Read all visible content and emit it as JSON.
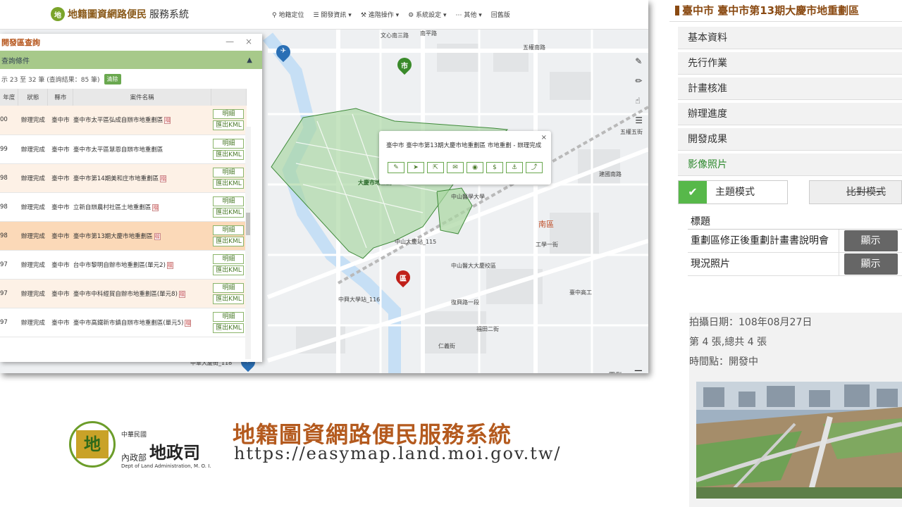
{
  "brand": {
    "logo": "地",
    "title_bold": "地籍圖資網路便民",
    "title_rest": "服務系統"
  },
  "menu": [
    {
      "icon": "pin-icon",
      "label": "地籍定位"
    },
    {
      "icon": "layers-icon",
      "label": "開發資訊"
    },
    {
      "icon": "tools-icon",
      "label": "進階操作"
    },
    {
      "icon": "gear-icon",
      "label": "系統設定"
    },
    {
      "icon": "more-icon",
      "label": "其他"
    },
    {
      "icon": "",
      "label": "回舊版"
    }
  ],
  "panel": {
    "title": "開發區查詢",
    "controls": "— ×",
    "condition_label": "查詢條件",
    "count_text": "示 23 至 32 筆 (查詢結果：85 筆)",
    "clear_label": "清除",
    "headers": [
      "年度",
      "狀態",
      "縣市",
      "案件名稱",
      ""
    ],
    "rows": [
      {
        "year": "00",
        "status": "辦理完成",
        "city": "臺中市",
        "name": "臺中市太平區弘成自辦市地重劃區",
        "tag": true,
        "style": "alt"
      },
      {
        "year": "99",
        "status": "辦理完成",
        "city": "臺中市",
        "name": "臺中市太平區慧恩自辦市地重劃區",
        "tag": false,
        "style": ""
      },
      {
        "year": "98",
        "status": "辦理完成",
        "city": "臺中市",
        "name": "臺中市第14期美和庄市地重劃區",
        "tag": true,
        "style": "alt"
      },
      {
        "year": "98",
        "status": "辦理完成",
        "city": "臺中市",
        "name": "立新自辦農村社區土地重劃區",
        "tag": true,
        "style": ""
      },
      {
        "year": "98",
        "status": "辦理完成",
        "city": "臺中市",
        "name": "臺中市第13期大慶市地重劃區",
        "tag": true,
        "style": "sel"
      },
      {
        "year": "97",
        "status": "辦理完成",
        "city": "臺中市",
        "name": "台中市黎明自辦市地重劃區(單元2)",
        "tag": true,
        "style": ""
      },
      {
        "year": "97",
        "status": "辦理完成",
        "city": "臺中市",
        "name": "臺中市中科經貿自辦市地重劃區(單元8)",
        "tag": true,
        "style": "alt"
      },
      {
        "year": "97",
        "status": "辦理完成",
        "city": "臺中市",
        "name": "臺中市高鐵新市鎮自辦市地重劃區(單元5)",
        "tag": true,
        "style": ""
      }
    ],
    "detail_label": "明細",
    "kml_label": "匯出KML",
    "tag_glyph": "檔"
  },
  "popup": {
    "text": "臺中市 臺中市第13期大慶市地重劃區 市地重劃 - 辦理完成",
    "close": "×",
    "buttons": [
      "✎",
      "➤",
      "⇱",
      "✉",
      "◉",
      "$",
      "⚓",
      "⤴"
    ]
  },
  "map": {
    "district_label": "南區",
    "zone_label": "大慶市地重劃",
    "pin_city": "市",
    "pin_zone": "區",
    "legend_label": "圖例",
    "labels": [
      "文心南三路",
      "五權南路",
      "中山醫學大學",
      "中山大慶站_115",
      "中興大學站_116",
      "中山醫大大慶校區",
      "臺中高工",
      "五權五街",
      "建國南路",
      "工學一街",
      "復興路一段",
      "福田二街",
      "仁義街",
      "中華大慶街_118",
      "南平路"
    ]
  },
  "side": {
    "title": "臺中市 臺中市第13期大慶市地重劃區",
    "sections": [
      "基本資料",
      "先行作業",
      "計畫核准",
      "辦理進度",
      "開發成果",
      "影像照片"
    ],
    "mode_on": "主題模式",
    "mode_on_check": "✔",
    "mode_off": "比對模式",
    "doc_header": "標題",
    "docs": [
      {
        "label": "重劃區修正後重劃計畫書說明會",
        "action": "顯示"
      },
      {
        "label": "現況照片",
        "action": "顯示"
      }
    ],
    "photo_date": "拍攝日期：108年08月27日",
    "photo_count": "第 4 張,總共 4 張",
    "photo_stage": "時間點：開發中"
  },
  "footer": {
    "logo_glyph": "地",
    "org_small": "中華民國",
    "org_small2": "內政部",
    "org_big": "地政司",
    "org_en": "Dept of Land Administration, M. O. I.",
    "system_name": "地籍圖資網路便民服務系統",
    "url": "https://easymap.land.moi.gov.tw/"
  },
  "colors": {
    "accent_green": "#6aa84f",
    "brand_brown": "#b45a1e",
    "zone_fill": "#a8d5a0"
  }
}
